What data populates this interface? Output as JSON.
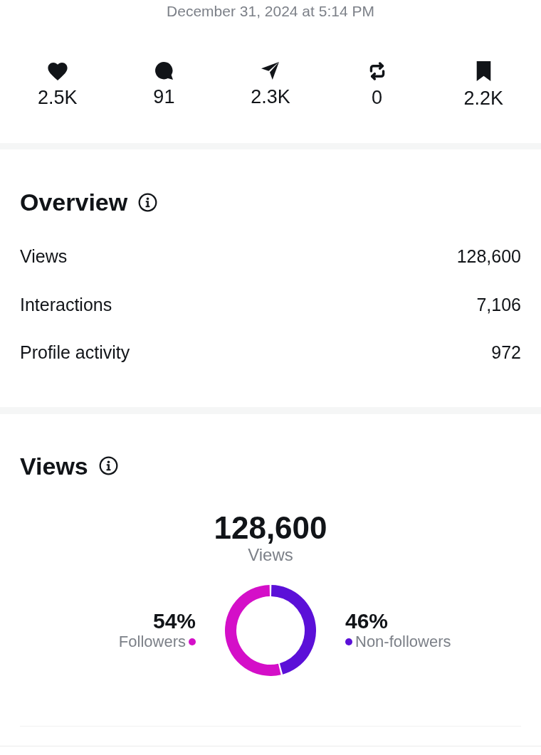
{
  "post_date": "December 31, 2024 at 5:14 PM",
  "stats": [
    {
      "kind": "likes",
      "value": "2.5K"
    },
    {
      "kind": "replies",
      "value": "91"
    },
    {
      "kind": "shares",
      "value": "2.3K"
    },
    {
      "kind": "reposts",
      "value": "0"
    },
    {
      "kind": "saves",
      "value": "2.2K"
    }
  ],
  "overview": {
    "title": "Overview",
    "rows": [
      {
        "label": "Views",
        "value": "128,600"
      },
      {
        "label": "Interactions",
        "value": "7,106"
      },
      {
        "label": "Profile activity",
        "value": "972"
      }
    ]
  },
  "views": {
    "title": "Views",
    "total": "128,600",
    "chart_data": {
      "type": "donut",
      "categories": [
        "Followers",
        "Non-followers"
      ],
      "series": [
        {
          "name": "Views",
          "values": [
            54,
            46
          ]
        }
      ]
    },
    "legend": [
      {
        "percent": "54%",
        "color": "#d40fc8"
      },
      {
        "percent": "46%",
        "color": "#5b10d8"
      }
    ]
  }
}
